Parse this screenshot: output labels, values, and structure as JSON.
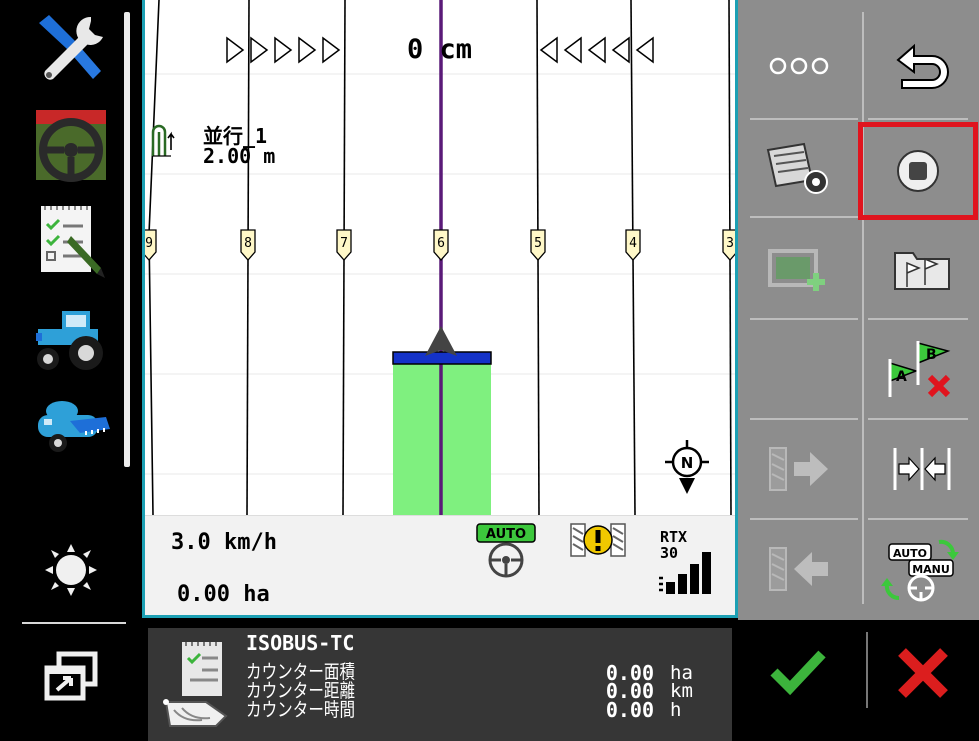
{
  "map": {
    "offset_value": "0 cm",
    "parallel_label": "並行_1",
    "parallel_width": "2.00 m",
    "track_numbers": [
      "9",
      "8",
      "7",
      "6",
      "5",
      "4",
      "3"
    ],
    "compass_label": "N"
  },
  "status": {
    "speed": "3.0 km/h",
    "area": "0.00 ha",
    "steering_mode": "AUTO",
    "rtx_label": "RTX",
    "rtx_level": "30"
  },
  "grid": {
    "record_button_highlight": "#e0141e",
    "auto_manu_top": "AUTO",
    "auto_manu_bottom": "MANU",
    "ab_a": "A",
    "ab_b": "B"
  },
  "task": {
    "title": "ISOBUS-TC",
    "counters": [
      {
        "label": "カウンター面積",
        "value": "0.00",
        "unit": "ha"
      },
      {
        "label": "カウンター距離",
        "value": "0.00",
        "unit": "km"
      },
      {
        "label": "カウンター時間",
        "value": "0.00",
        "unit": "h"
      }
    ]
  },
  "colors": {
    "accent": "#1ca0b4",
    "guidance_line": "#5a1a78",
    "coverage": "#7ff07f",
    "boom": "#1432c8",
    "confirm": "#3cb43c",
    "cancel": "#dc1e1e"
  }
}
